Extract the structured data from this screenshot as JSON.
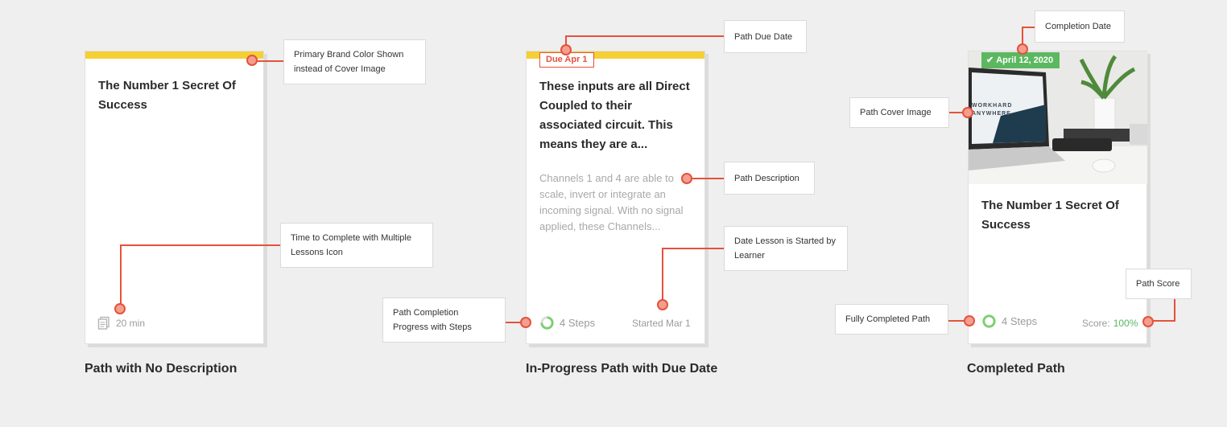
{
  "cards": {
    "no_desc": {
      "title": "The Number 1 Secret Of Success",
      "time": "20 min",
      "caption": "Path with No Description",
      "brand_color": "#f5cf36"
    },
    "in_progress": {
      "due": "Due Apr 1",
      "title": "These inputs are all Direct Coupled to their associated circuit. This means they are a...",
      "description": "Channels 1 and 4 are able to scale, invert or integrate an incoming signal. With no signal applied, these Channels...",
      "steps": "4 Steps",
      "started": "Started Mar 1",
      "caption": "In-Progress Path with Due Date"
    },
    "completed": {
      "completion_date": "April 12, 2020",
      "cover_text": "WORKHARD ANYWHERE",
      "title": "The Number 1 Secret Of Success",
      "steps": "4 Steps",
      "score_label": "Score:",
      "score_value": "100%",
      "caption": "Completed Path"
    }
  },
  "callouts": {
    "brand_color": "Primary Brand Color Shown instead of Cover Image",
    "time_complete": "Time to Complete with Multiple Lessons Icon",
    "due_date": "Path Due Date",
    "description": "Path Description",
    "date_started": "Date Lesson is Started by Learner",
    "progress": "Path Completion Progress with Steps",
    "completion_date": "Completion Date",
    "cover_image": "Path Cover Image",
    "fully_completed": "Fully Completed Path",
    "score": "Path Score"
  },
  "colors": {
    "accent": "#e4523b",
    "brand": "#f5cf36",
    "success": "#5cb860",
    "progress": "#7bcf6f"
  },
  "icons": {
    "lessons": "multiple-lessons-icon",
    "progress": "progress-ring-icon",
    "check": "check-icon"
  }
}
